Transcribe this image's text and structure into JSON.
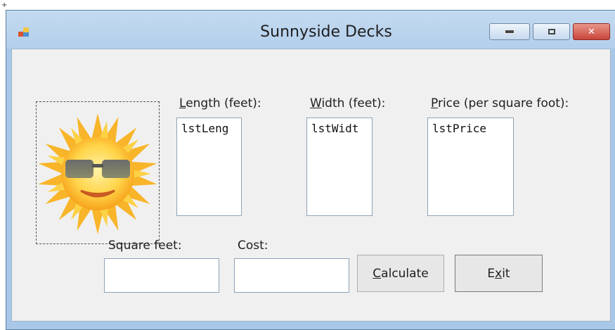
{
  "window": {
    "title": "Sunnyside Decks",
    "caption_buttons": {
      "minimize": "minimize-icon",
      "maximize": "maximize-icon",
      "close": "close-icon"
    }
  },
  "image": {
    "icon": "sun-with-sunglasses"
  },
  "labels": {
    "length": {
      "mnemonic": "L",
      "rest": "ength (feet):"
    },
    "width": {
      "mnemonic": "W",
      "rest": "idth (feet):"
    },
    "price": {
      "mnemonic": "P",
      "rest": "rice (per square foot):"
    },
    "square_feet": "Square feet:",
    "cost": "Cost:"
  },
  "listboxes": {
    "length": "lstLeng",
    "width": "lstWidt",
    "price": "lstPrice"
  },
  "textboxes": {
    "square_feet": "",
    "cost": ""
  },
  "buttons": {
    "calculate": {
      "mnemonic": "C",
      "rest": "alculate"
    },
    "exit": {
      "before": "E",
      "mnemonic": "x",
      "after": "it"
    }
  },
  "colors": {
    "titlebar": "#b3cfec",
    "close_button": "#c8453a",
    "client": "#f0f0f0"
  }
}
